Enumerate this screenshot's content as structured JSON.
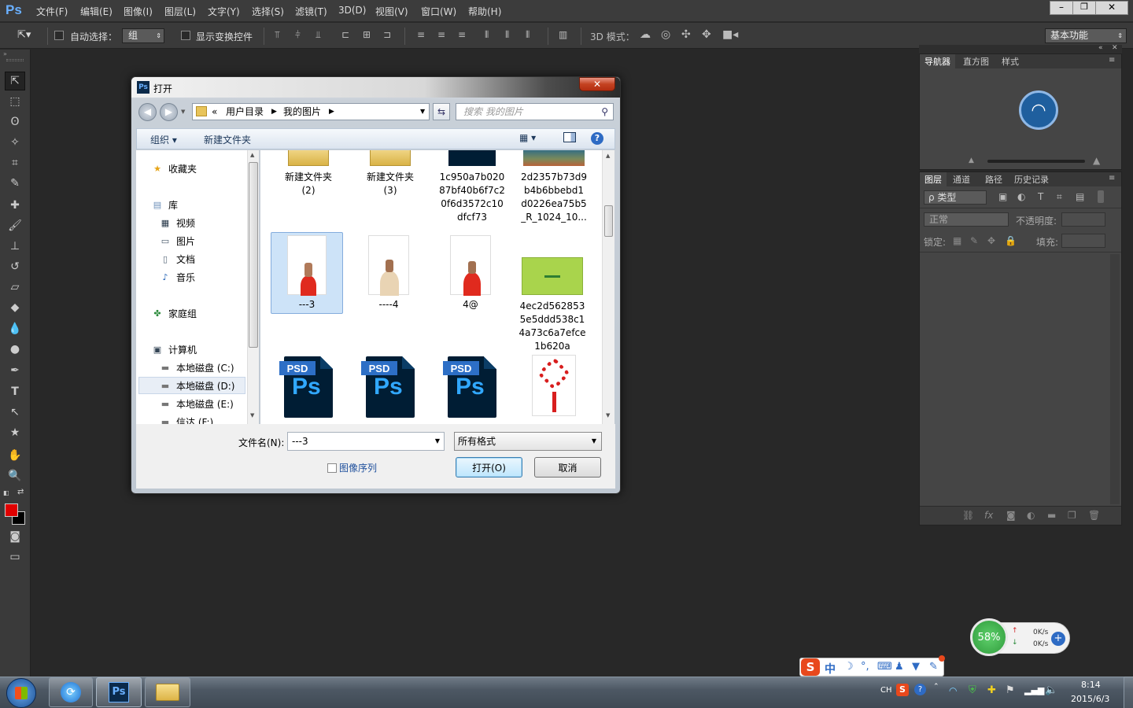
{
  "app": {
    "logo": "Ps"
  },
  "menu": [
    "文件(F)",
    "编辑(E)",
    "图像(I)",
    "图层(L)",
    "文字(Y)",
    "选择(S)",
    "滤镜(T)",
    "3D(D)",
    "视图(V)",
    "窗口(W)",
    "帮助(H)"
  ],
  "window_controls": {
    "minimize": "–",
    "restore": "❐",
    "close": "✕"
  },
  "options_bar": {
    "auto_select_label": "自动选择：",
    "auto_select_value": "组",
    "show_transform_label": "显示变换控件",
    "mode_3d_label": "3D 模式：",
    "workspace": "基本功能"
  },
  "dialog": {
    "title": "打开",
    "breadcrumb": [
      "«",
      "用户目录",
      "我的图片"
    ],
    "search_placeholder": "搜索 我的图片",
    "organize": "组织 ▾",
    "new_folder": "新建文件夹",
    "nav": {
      "favorites": "收藏夹",
      "library": "库",
      "library_items": [
        "视频",
        "图片",
        "文档",
        "音乐"
      ],
      "homegroup": "家庭组",
      "computer": "计算机",
      "drives": [
        "本地磁盘 (C:)",
        "本地磁盘 (D:)",
        "本地磁盘 (E:)",
        "信达 (F:)"
      ]
    },
    "files": [
      {
        "name": "新建文件夹 (2)"
      },
      {
        "name": "新建文件夹 (3)"
      },
      {
        "name": "1c950a7b020 87bf40b6f7c2 0f6d3572c10 dfcf73"
      },
      {
        "name": "2d2357b73d9 b4b6bbebd1 d0226ea75b5 _R_1024_10..."
      },
      {
        "name": "---3"
      },
      {
        "name": "----4"
      },
      {
        "name": "4@"
      },
      {
        "name": "4ec2d562853 5e5ddd538c1 4a73c6a7efce 1b620a"
      },
      {
        "name": "PSD"
      },
      {
        "name": "PSD"
      },
      {
        "name": "PSD"
      },
      {
        "name": ""
      }
    ],
    "psd_tag": "PSD",
    "psd_letters": "Ps",
    "filename_label": "文件名(N):",
    "filename_value": "---3",
    "filetype_value": "所有格式",
    "image_sequence": "图像序列",
    "open_button": "打开(O)",
    "cancel_button": "取消"
  },
  "panels": {
    "top_tabs": [
      "导航器",
      "直方图",
      "样式"
    ],
    "layer_tabs": [
      "图层",
      "通道",
      "路径",
      "历史记录"
    ],
    "kind_filter": "ρ 类型",
    "blend_mode": "正常",
    "opacity_label": "不透明度:",
    "lock_label": "锁定:",
    "fill_label": "填充:"
  },
  "net_widget": {
    "percent": "58%",
    "up": "0K/s",
    "down": "0K/s"
  },
  "ime_bar": {
    "label": "中"
  },
  "taskbar": {
    "lang": "CH",
    "time": "8:14",
    "date": "2015/6/3"
  },
  "colors": {
    "accent": "#3a7bd5",
    "fg_color": "#e00000",
    "bg_color": "#000000",
    "net_green": "#3cb54a"
  }
}
